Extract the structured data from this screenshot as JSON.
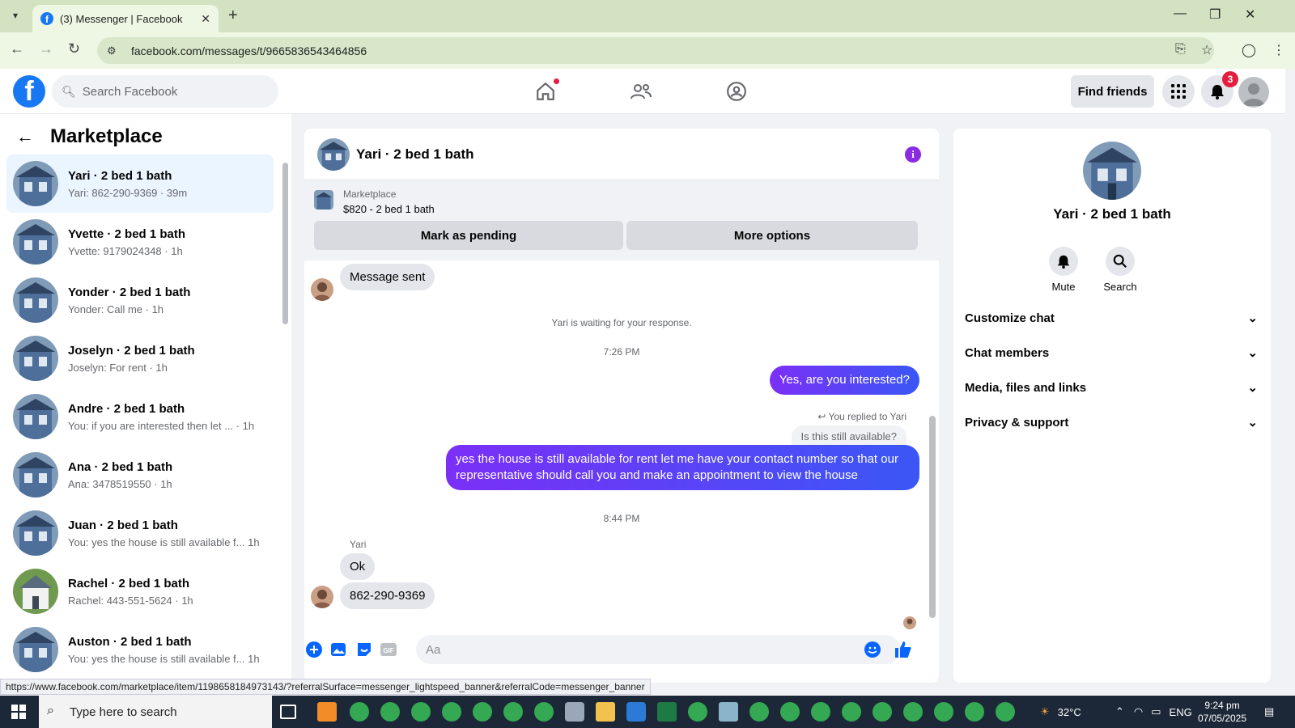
{
  "browser": {
    "tab_title": "(3) Messenger | Facebook",
    "url": "facebook.com/messages/t/9665836543464856",
    "status_url": "https://www.facebook.com/marketplace/item/1198658184973143/?referralSurface=messenger_lightspeed_banner&referralCode=messenger_banner"
  },
  "header": {
    "search_placeholder": "Search Facebook",
    "find_friends": "Find friends",
    "notification_count": "3"
  },
  "sidebar": {
    "title": "Marketplace",
    "conversations": [
      {
        "name": "Yari · 2 bed 1 bath",
        "preview": "Yari: 862-290-9369 · 39m",
        "active": true
      },
      {
        "name": "Yvette · 2 bed 1 bath",
        "preview": "Yvette: 9179024348 · 1h"
      },
      {
        "name": "Yonder · 2 bed 1 bath",
        "preview": "Yonder: Call me · 1h"
      },
      {
        "name": "Joselyn · 2 bed 1 bath",
        "preview": "Joselyn: For rent · 1h"
      },
      {
        "name": "Andre · 2 bed 1 bath",
        "preview": "You: if you are interested then let ...   · 1h"
      },
      {
        "name": "Ana · 2 bed 1 bath",
        "preview": "Ana: 3478519550 · 1h"
      },
      {
        "name": "Juan · 2 bed 1 bath",
        "preview": "You: yes the house is still available f...   1h"
      },
      {
        "name": "Rachel · 2 bed 1 bath",
        "preview": "Rachel: 443-551-5624 · 1h"
      },
      {
        "name": "Auston · 2 bed 1 bath",
        "preview": "You: yes the house is still available f...   1h"
      }
    ]
  },
  "chat": {
    "title": "Yari · 2 bed 1 bath",
    "banner_label": "Marketplace",
    "banner_price": "$820 - 2 bed 1 bath",
    "mark_pending": "Mark as pending",
    "more_options": "More options",
    "msg_sent": "Message sent",
    "waiting": "Yari is waiting for your response.",
    "time1": "7:26 PM",
    "out1": "Yes, are you interested?",
    "replied_to": "You replied to Yari",
    "quoted": "Is this still available?",
    "out2": "yes the house is still available for rent let me have your contact number so that our representative should call you and make an appointment to view the house",
    "time2": "8:44 PM",
    "sender": "Yari",
    "in1": "Ok",
    "in2": "862-290-9369",
    "composer_placeholder": "Aa"
  },
  "details": {
    "name": "Yari · 2 bed 1 bath",
    "mute": "Mute",
    "search": "Search",
    "sections": [
      "Customize chat",
      "Chat members",
      "Media, files and links",
      "Privacy & support"
    ]
  },
  "taskbar": {
    "search_placeholder": "Type here to search",
    "temperature": "32°C",
    "lang": "ENG",
    "time": "9:24 pm",
    "date": "07/05/2025"
  },
  "colors": {
    "brand": "#1877f2",
    "outgoing": "#6c3ef5",
    "info": "#8a2be2"
  }
}
